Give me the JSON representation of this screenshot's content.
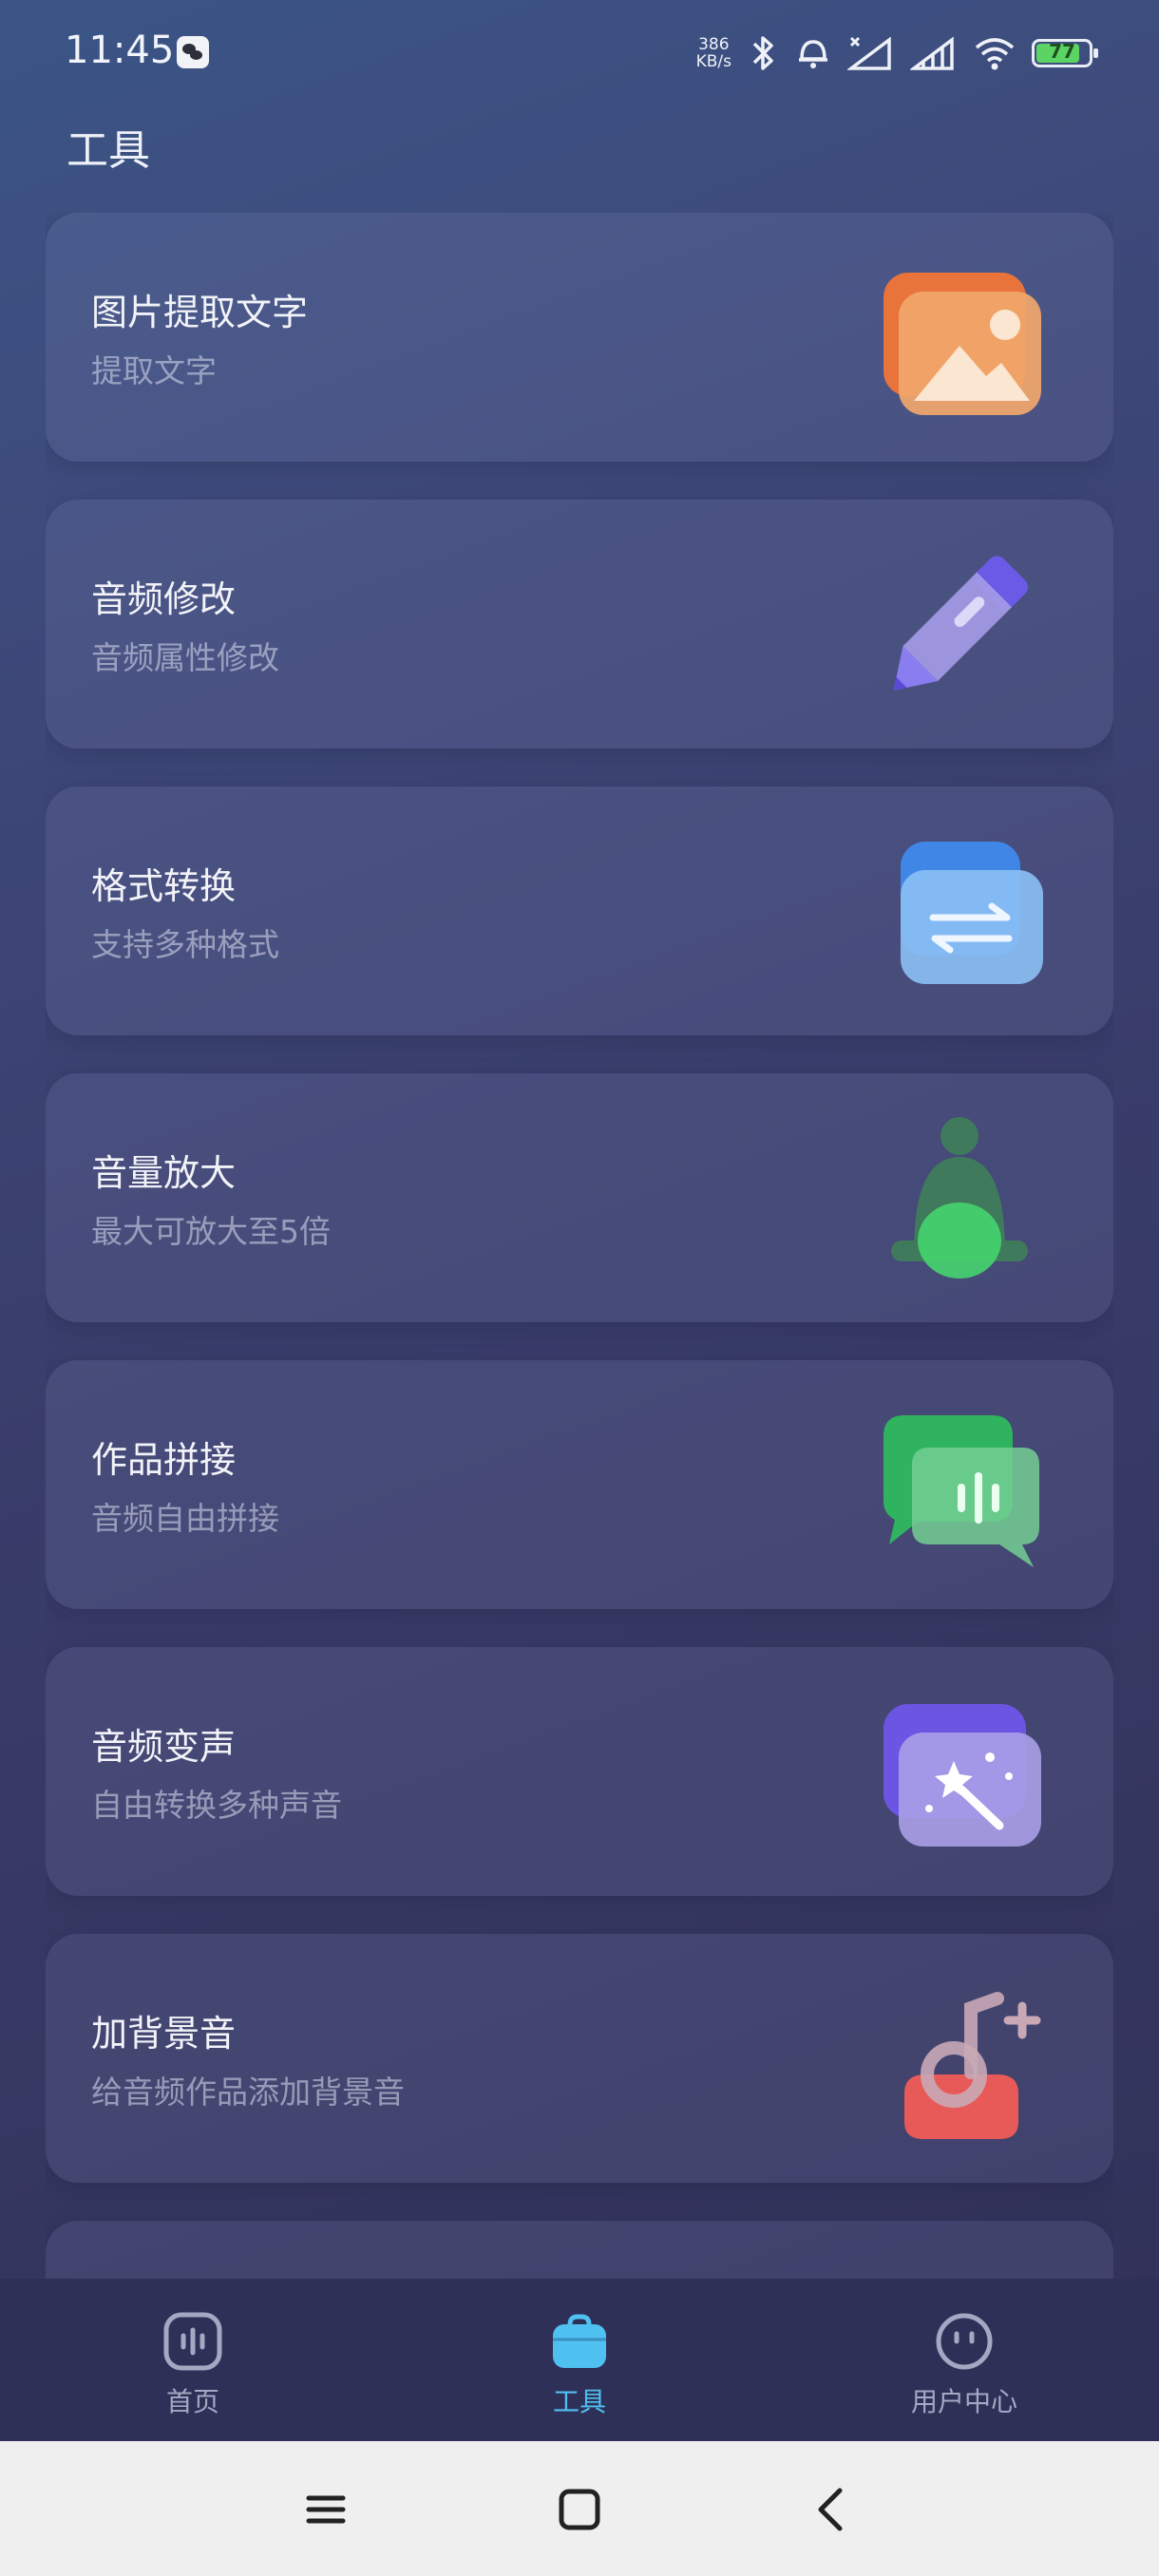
{
  "status_bar": {
    "time": "11:45",
    "net_speed_value": "386",
    "net_speed_unit": "KB/s",
    "battery": "77"
  },
  "page": {
    "title": "工具"
  },
  "tools": [
    {
      "title": "图片提取文字",
      "subtitle": "提取文字",
      "icon": "image-icon"
    },
    {
      "title": "音频修改",
      "subtitle": "音频属性修改",
      "icon": "pencil-icon"
    },
    {
      "title": "格式转换",
      "subtitle": "支持多种格式",
      "icon": "convert-icon"
    },
    {
      "title": "音量放大",
      "subtitle": "最大可放大至5倍",
      "icon": "bell-icon"
    },
    {
      "title": "作品拼接",
      "subtitle": "音频自由拼接",
      "icon": "chat-waveform-icon"
    },
    {
      "title": "音频变声",
      "subtitle": "自由转换多种声音",
      "icon": "magic-wand-icon"
    },
    {
      "title": "加背景音",
      "subtitle": "给音频作品添加背景音",
      "icon": "music-add-icon"
    }
  ],
  "tab_bar": {
    "items": [
      {
        "label": "首页",
        "icon": "home-waveform-icon",
        "active": false
      },
      {
        "label": "工具",
        "icon": "toolbox-icon",
        "active": true
      },
      {
        "label": "用户中心",
        "icon": "user-face-icon",
        "active": false
      }
    ],
    "active_color": "#4fc1f0",
    "inactive_color": "#a4a8c2"
  },
  "system_nav": {
    "buttons": [
      "menu-icon",
      "home-square-icon",
      "back-icon"
    ]
  }
}
